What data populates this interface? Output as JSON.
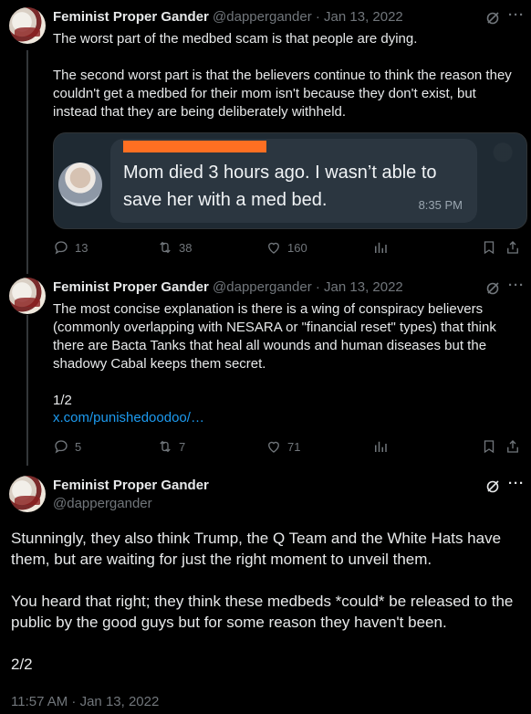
{
  "tweets": [
    {
      "name": "Feminist Proper Gander",
      "handle": "@dappergander",
      "dot": "·",
      "date": "Jan 13, 2022",
      "text": "The worst part of the medbed scam is that people are dying.\n\nThe second worst part is that the believers continue to think the reason they couldn't get a medbed for their mom isn't because they don't exist, but instead that they are being deliberately withheld.",
      "media": {
        "message": "Mom died 3 hours ago. I wasn’t able to save her with a med bed.",
        "time": "8:35 PM"
      },
      "actions": {
        "replies": "13",
        "reposts": "38",
        "likes": "160"
      }
    },
    {
      "name": "Feminist Proper Gander",
      "handle": "@dappergander",
      "dot": "·",
      "date": "Jan 13, 2022",
      "text": "The most concise explanation is there is a wing of conspiracy believers (commonly overlapping with NESARA or \"financial reset\" types) that think there are Bacta Tanks that heal all wounds and human diseases but the shadowy Cabal keeps them secret.\n\n1/2",
      "link": "x.com/punishedoodoo/…",
      "actions": {
        "replies": "5",
        "reposts": "7",
        "likes": "71"
      }
    }
  ],
  "main_tweet": {
    "name": "Feminist Proper Gander",
    "handle": "@dappergander",
    "text": "Stunningly, they also think Trump, the Q Team and the White Hats have them, but are waiting for just the right moment to unveil them.\n\nYou heard that right; they think these medbeds *could* be released to the public by the good guys but for some reason they haven't been.\n\n2/2",
    "timestamp": "11:57 AM · Jan 13, 2022"
  },
  "icons": [
    "grok-icon",
    "more-icon",
    "reply-icon",
    "repost-icon",
    "like-icon",
    "views-icon",
    "bookmark-icon",
    "share-icon"
  ],
  "colors": {
    "background": "#000000",
    "text": "#e7e9ea",
    "secondary": "#71767b",
    "link": "#1d9bf0",
    "redaction": "#ff6f22"
  }
}
